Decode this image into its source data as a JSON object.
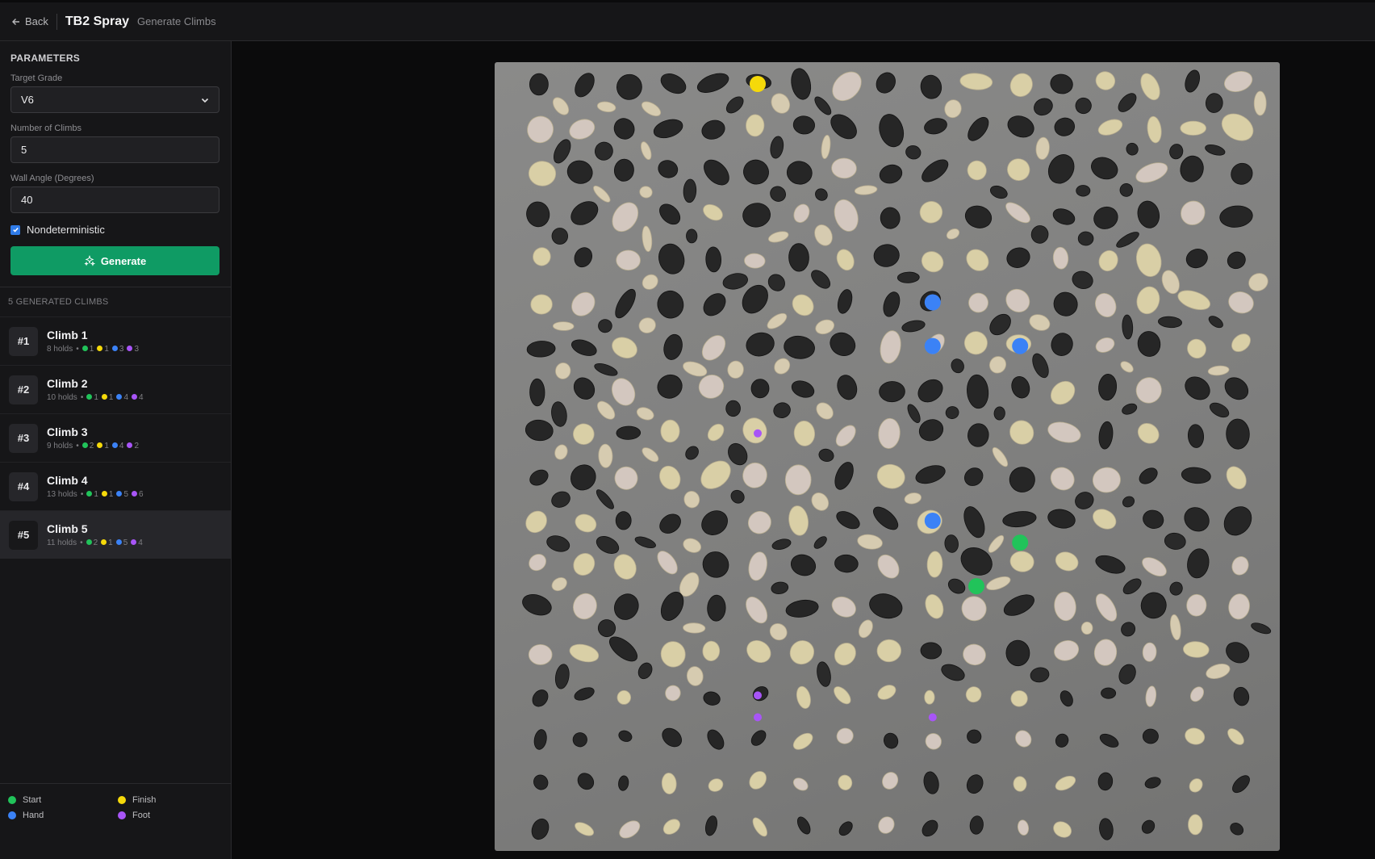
{
  "header": {
    "back_label": "Back",
    "title": "TB2 Spray",
    "subtitle": "Generate Climbs"
  },
  "params": {
    "section_title": "PARAMETERS",
    "grade_label": "Target Grade",
    "grade_value": "V6",
    "count_label": "Number of Climbs",
    "count_value": "5",
    "angle_label": "Wall Angle (Degrees)",
    "angle_value": "40",
    "nondeterministic_label": "Nondeterministic",
    "nondeterministic_checked": true,
    "generate_label": "Generate"
  },
  "generated": {
    "header": "5 GENERATED CLIMBS",
    "climbs": [
      {
        "num": "#1",
        "name": "Climb 1",
        "holds": "8 holds",
        "start": "1",
        "finish": "1",
        "hand": "3",
        "foot": "3"
      },
      {
        "num": "#2",
        "name": "Climb 2",
        "holds": "10 holds",
        "start": "1",
        "finish": "1",
        "hand": "4",
        "foot": "4"
      },
      {
        "num": "#3",
        "name": "Climb 3",
        "holds": "9 holds",
        "start": "2",
        "finish": "1",
        "hand": "4",
        "foot": "2"
      },
      {
        "num": "#4",
        "name": "Climb 4",
        "holds": "13 holds",
        "start": "1",
        "finish": "1",
        "hand": "5",
        "foot": "6"
      },
      {
        "num": "#5",
        "name": "Climb 5",
        "holds": "11 holds",
        "start": "2",
        "finish": "1",
        "hand": "5",
        "foot": "4"
      }
    ],
    "selected_index": 4
  },
  "legend": {
    "start": "Start",
    "finish": "Finish",
    "hand": "Hand",
    "foot": "Foot"
  },
  "colors": {
    "start": "#21c35a",
    "finish": "#f5d90a",
    "hand": "#3b82f6",
    "foot": "#a855f7",
    "accent": "#0f9b64"
  },
  "board": {
    "marked_holds": [
      {
        "role": "finish",
        "col": 5,
        "row": 0
      },
      {
        "role": "hand",
        "col": 9,
        "row": 5
      },
      {
        "role": "hand",
        "col": 9,
        "row": 6
      },
      {
        "role": "hand",
        "col": 11,
        "row": 6
      },
      {
        "role": "hand",
        "col": 9,
        "row": 10
      },
      {
        "role": "start",
        "col": 11,
        "row": 10.5
      },
      {
        "role": "start",
        "col": 10,
        "row": 11.5
      },
      {
        "role": "foot",
        "col": 5,
        "row": 8
      },
      {
        "role": "foot",
        "col": 5,
        "row": 14
      },
      {
        "role": "foot",
        "col": 5,
        "row": 14.5
      },
      {
        "role": "foot",
        "col": 9,
        "row": 14.5
      }
    ]
  }
}
